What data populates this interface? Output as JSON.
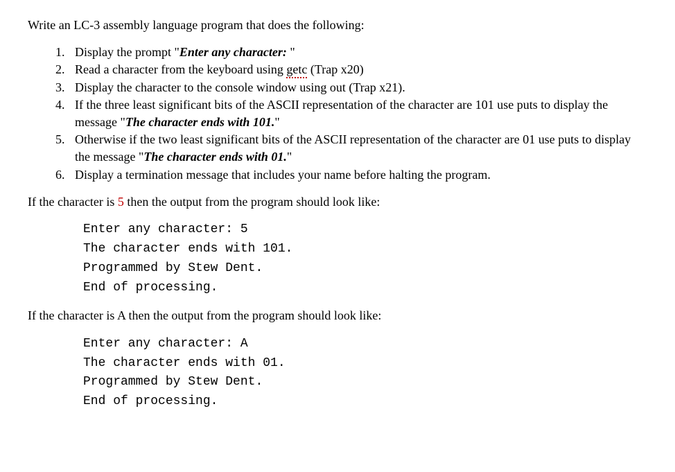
{
  "intro": "Write an LC-3 assembly language program that does the following:",
  "items": {
    "i1a": "Display the prompt \"",
    "i1b": "Enter any character:",
    "i1c": " \"",
    "i2a": "Read a character from the keyboard using ",
    "i2b": "getc",
    "i2c": " (Trap x20)",
    "i3": "Display the character to the console window using out (Trap x21).",
    "i4a": "If the three least significant bits of the ASCII representation of the character are 101 use puts to display the message \"",
    "i4b": "The character ends with 101.",
    "i4c": "\"",
    "i5a": "Otherwise if the two least significant bits of the ASCII representation of the character are 01 use puts to display the message \"",
    "i5b": "The character ends with 01.",
    "i5c": "\"",
    "i6": "Display a termination message that includes your name before halting the program."
  },
  "example1": {
    "lead_a": "If the character is ",
    "lead_b": "5",
    "lead_c": " then the output from the program should look like:",
    "code": "Enter any character: 5\nThe character ends with 101.\nProgrammed by Stew Dent.\nEnd of processing."
  },
  "example2": {
    "lead_a": "If the character is ",
    "lead_b": "A",
    "lead_c": " then the output from the program should look like:",
    "code": "Enter any character: A\nThe character ends with 01.\nProgrammed by Stew Dent.\nEnd of processing."
  }
}
